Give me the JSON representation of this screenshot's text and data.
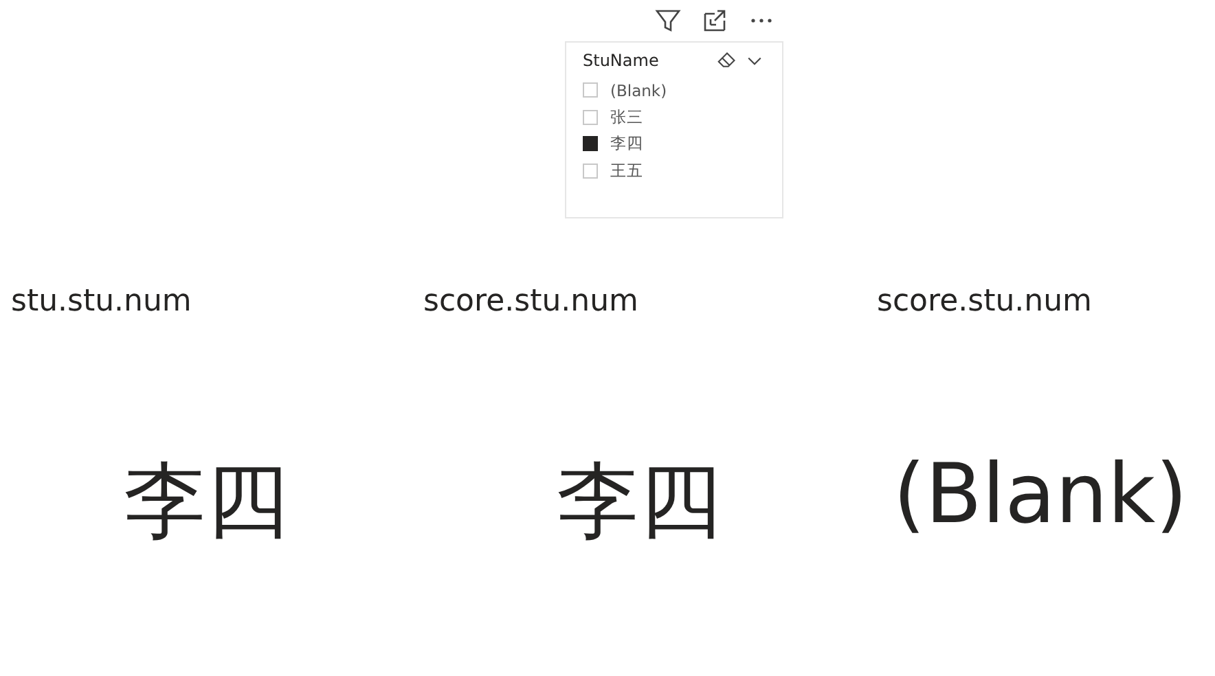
{
  "slicer": {
    "title": "StuName",
    "items": [
      {
        "label": "(Blank)",
        "checked": false
      },
      {
        "label": "张三",
        "checked": false
      },
      {
        "label": "李四",
        "checked": true
      },
      {
        "label": "王五",
        "checked": false
      }
    ]
  },
  "cards": [
    {
      "label": "stu.stu.num",
      "value": "李四"
    },
    {
      "label": "score.stu.num",
      "value": "李四"
    },
    {
      "label": "score.stu.num",
      "value": "(Blank)"
    }
  ]
}
